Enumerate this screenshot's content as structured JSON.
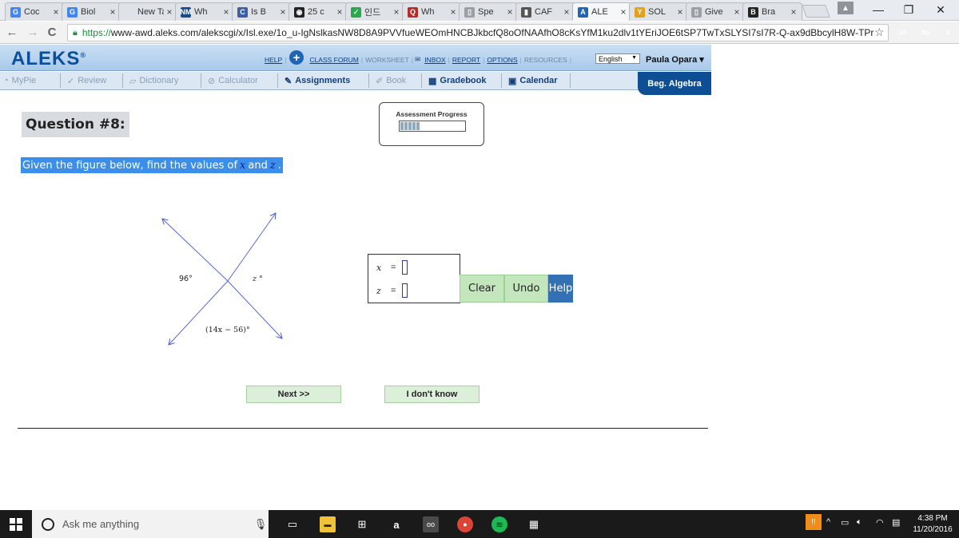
{
  "browser": {
    "tabs": [
      {
        "label": "Coc",
        "favicon": "G",
        "favicon_color": "#4285f4",
        "active": false
      },
      {
        "label": "Biol",
        "favicon": "G",
        "favicon_color": "#4285f4",
        "active": false
      },
      {
        "label": "New Tal",
        "favicon": "",
        "favicon_color": "#dfe3e8",
        "active": false
      },
      {
        "label": "Wh",
        "favicon": "NM",
        "favicon_color": "#1b4a8a",
        "active": false
      },
      {
        "label": "Is B",
        "favicon": "C",
        "favicon_color": "#3b5fa8",
        "active": false
      },
      {
        "label": "25 c",
        "favicon": "◉",
        "favicon_color": "#222222",
        "active": false
      },
      {
        "label": "인드",
        "favicon": "✓",
        "favicon_color": "#2aa84a",
        "active": false
      },
      {
        "label": "Wh",
        "favicon": "Q",
        "favicon_color": "#b92b27",
        "active": false
      },
      {
        "label": "Spe",
        "favicon": "▯",
        "favicon_color": "#9aa0a6",
        "active": false
      },
      {
        "label": "CAF",
        "favicon": "▮",
        "favicon_color": "#555555",
        "active": false
      },
      {
        "label": "ALE",
        "favicon": "A",
        "favicon_color": "#1f64b6",
        "active": true
      },
      {
        "label": "SOL",
        "favicon": "Y",
        "favicon_color": "#e3a21a",
        "active": false
      },
      {
        "label": "Give",
        "favicon": "▯",
        "favicon_color": "#9aa0a6",
        "active": false
      },
      {
        "label": "Bra",
        "favicon": "B",
        "favicon_color": "#222222",
        "active": false
      }
    ],
    "tab_close": "×",
    "window_controls": {
      "minimize": "—",
      "restore": "❐",
      "close": "✕"
    },
    "nav": {
      "back": "←",
      "forward": "→",
      "reload": "C"
    },
    "url_scheme": "https://",
    "url_rest": "www-awd.aleks.com/alekscgi/x/Isl.exe/1o_u-IgNslkasNW8D8A9PVVfueWEOmHNCBJkbcfQ8oOfNAAfhO8cKsYfM1ku2dlv1tYEriJOE6tSP7TwTxSLYSI7sI7R-Q-ax9dBbcylH8W-TPr",
    "bookmark_icon": "☆",
    "extensions": [
      {
        "label": "uo",
        "color": "#a8151a"
      },
      {
        "label": "hp",
        "color": "#1b77d2"
      },
      {
        "label": "o",
        "color": "#f29900"
      }
    ]
  },
  "aleks": {
    "logo": "ALEKS",
    "logo_mark": "®",
    "help": "HELP",
    "class_forum": "CLASS FORUM",
    "worksheet": "WORKSHEET",
    "inbox": "INBOX",
    "report": "REPORT",
    "options": "OPTIONS",
    "resources": "RESOURCES",
    "language": "English",
    "user": "Paula Opara ▾",
    "nav_tabs": [
      {
        "label": "MyPie",
        "icon": "◔",
        "enabled": false
      },
      {
        "label": "Review",
        "icon": "✓",
        "enabled": false
      },
      {
        "label": "Dictionary",
        "icon": "▱",
        "enabled": false
      },
      {
        "label": "Calculator",
        "icon": "⊘",
        "enabled": false
      },
      {
        "label": "Assignments",
        "icon": "✎",
        "enabled": true
      },
      {
        "label": "Book",
        "icon": "✐",
        "enabled": false
      },
      {
        "label": "Gradebook",
        "icon": "▦",
        "enabled": true
      },
      {
        "label": "Calendar",
        "icon": "▣",
        "enabled": true
      }
    ],
    "course": "Beg. Algebra"
  },
  "question": {
    "title": "Question #8:",
    "progress_label": "Assessment Progress",
    "progress_fraction": 0.3,
    "prompt_pre": "Given the figure below, find the values of",
    "var_x": "x",
    "prompt_and": "and",
    "var_z": "z",
    "prompt_end": ".",
    "figure": {
      "angle_left": "96°",
      "angle_right": "z °",
      "angle_bottom": "(14x − 56)°"
    },
    "answers": [
      {
        "var": "x",
        "eq": "=",
        "value": ""
      },
      {
        "var": "z",
        "eq": "=",
        "value": ""
      }
    ],
    "buttons": {
      "clear": "Clear",
      "undo": "Undo",
      "help": "Help"
    },
    "next": "Next >>",
    "dont_know": "I don't know"
  },
  "taskbar": {
    "search_placeholder": "Ask me anything",
    "time": "4:38 PM",
    "date": "11/20/2016"
  }
}
